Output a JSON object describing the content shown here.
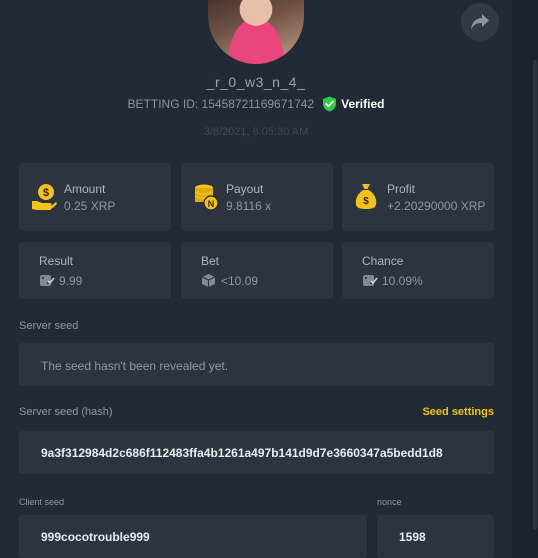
{
  "profile": {
    "username": "_r_0_w3_n_4_",
    "bet_id": "BETTING ID: 15458721169671742",
    "verified_label": "Verified",
    "date": "3/8/2021, 8:05:30 AM"
  },
  "stats": {
    "amount": {
      "label": "Amount",
      "value": "0.25 XRP"
    },
    "payout": {
      "label": "Payout",
      "value": "9.8116 x"
    },
    "profit": {
      "label": "Profit",
      "value": "+2.20290000 XRP"
    },
    "result": {
      "label": "Result",
      "value": "9.99"
    },
    "bet": {
      "label": "Bet",
      "value": "<10.09"
    },
    "chance": {
      "label": "Chance",
      "value": "10.09%"
    }
  },
  "seeds": {
    "server_seed_label": "Server seed",
    "server_seed_text": "The seed hasn't been revealed yet.",
    "server_hash_label": "Server seed (hash)",
    "seed_settings_label": "Seed settings",
    "server_hash_value": "9a3f312984d2c686f112483ffa4b1261a497b141d9d7e3660347a5bedd1d8",
    "client_seed_label": "Client seed",
    "client_seed_value": "999cocotrouble999",
    "nonce_label": "nonce",
    "nonce_value": "1598"
  },
  "colors": {
    "accent_gold": "#f4c21c",
    "verified_green": "#2ecc40",
    "background": "#222b35",
    "card": "#2b343f"
  },
  "icons": [
    "share-icon",
    "verified-check-icon",
    "coin-hand-icon",
    "coin-stack-icon",
    "money-bag-icon",
    "dice-icon",
    "cube-icon"
  ]
}
